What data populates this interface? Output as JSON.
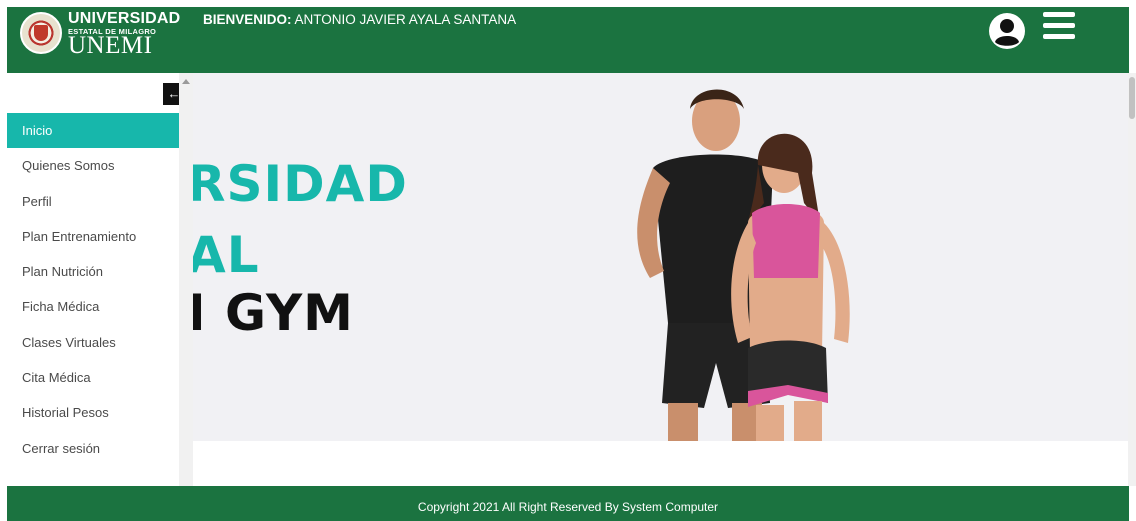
{
  "header": {
    "brand_line1": "UNIVERSIDAD",
    "brand_line2": "ESTATAL DE MILAGRO",
    "brand_line3": "UNEMI",
    "welcome_label": "BIENVENIDO:",
    "welcome_user": "ANTONIO JAVIER AYALA SANTANA",
    "user_icon": "user-circle-icon",
    "menu_icon": "hamburger-menu-icon",
    "color": "#1b7340"
  },
  "sidebar": {
    "collapse_icon": "arrow-left-icon",
    "active_color": "#17b7ab",
    "items": [
      {
        "label": "Inicio",
        "active": true
      },
      {
        "label": "Quienes Somos"
      },
      {
        "label": "Perfil"
      },
      {
        "label": "Plan Entrenamiento"
      },
      {
        "label": "Plan Nutrición"
      },
      {
        "label": "Ficha Médica"
      },
      {
        "label": "Clases Virtuales"
      },
      {
        "label": "Cita Médica"
      },
      {
        "label": "Historial Pesos"
      },
      {
        "label": "Cerrar sesión"
      }
    ]
  },
  "hero": {
    "line1": "RSIDAD",
    "line2": "AL",
    "line3": "I GYM",
    "accent_color": "#17b7ab"
  },
  "footer": {
    "text": "Copyright 2021 All Right Reserved By System Computer"
  }
}
